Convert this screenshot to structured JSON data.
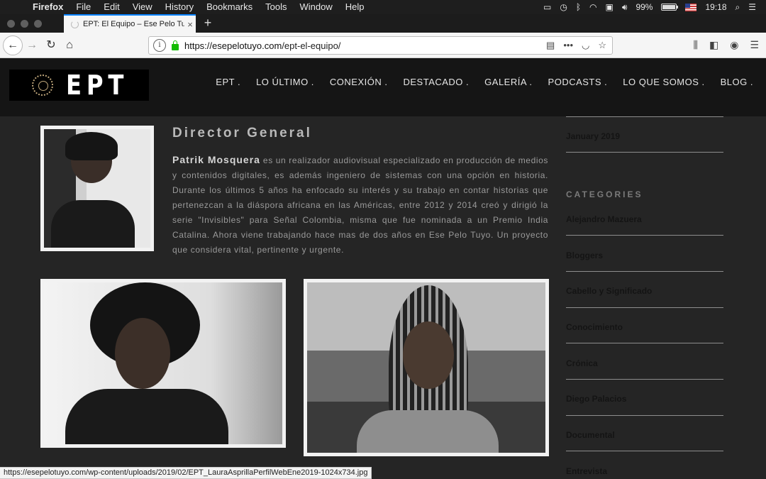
{
  "menubar": {
    "app": "Firefox",
    "items": [
      "File",
      "Edit",
      "View",
      "History",
      "Bookmarks",
      "Tools",
      "Window",
      "Help"
    ],
    "battery": "99%",
    "battery_level": 0.99,
    "clock": "19:18"
  },
  "tab": {
    "title": "EPT: El Equipo – Ese Pelo Tuyo",
    "close": "×",
    "new": "+"
  },
  "urlbar": {
    "url_host": "https://esepelotuyo.com",
    "url_path": "/ept-el-equipo/",
    "info": "i",
    "more": "•••"
  },
  "site": {
    "logo_text": "EPT",
    "nav": [
      "EPT .",
      "LO ÚLTIMO .",
      "CONEXIÓN .",
      "DESTACADO .",
      "GALERÍA .",
      "PODCASTS .",
      "LO QUE SOMOS .",
      "BLOG ."
    ]
  },
  "profile": {
    "role": "Director General",
    "name": "Patrik Mosquera",
    "bio": " es un realizador audiovisual especializado en producción de medios y contenidos digitales, es además ingeniero de sistemas con una opción en historia. Durante los últimos 5 años ha enfocado su interés y su trabajo en contar historias que pertenezcan a la diáspora africana en las Américas, entre 2012 y 2014 creó y dirigió la serie \"Invisibles\" para Señal Colombia, misma que fue nominada a un Premio India Catalina. Ahora viene trabajando hace mas de dos años en Ese Pelo Tuyo. Un proyecto que considera vital, pertinente y urgente."
  },
  "sidebar": {
    "archive_item": "January 2019",
    "categories_heading": "CATEGORIES",
    "categories": [
      "Alejandro Mazuera",
      "Bloggers",
      "Cabello y Significado",
      "Conocimiento",
      "Crónica",
      "Diego Palacios",
      "Documental",
      "Entrevista"
    ]
  },
  "statusbar": {
    "text": "https://esepelotuyo.com/wp-content/uploads/2019/02/EPT_LauraAsprillaPerfilWebEne2019-1024x734.jpg"
  }
}
